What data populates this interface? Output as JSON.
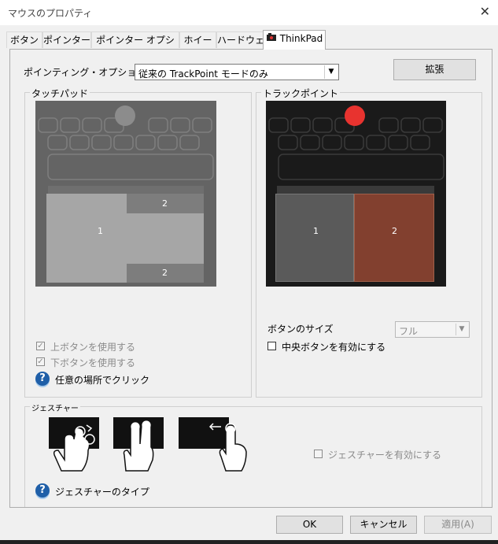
{
  "window": {
    "title": "マウスのプロパティ",
    "close_glyph": "✕"
  },
  "tabs": [
    {
      "label": "ボタン"
    },
    {
      "label": "ポインター"
    },
    {
      "label": "ポインター オプション"
    },
    {
      "label": "ホイール"
    },
    {
      "label": "ハードウェア"
    },
    {
      "label": "ThinkPad",
      "active": true
    }
  ],
  "pointing": {
    "label": "ポインティング・オプション",
    "selected": "従来の TrackPoint モードのみ",
    "expand_button": "拡張"
  },
  "touchpad": {
    "title": "タッチパッド",
    "zone_left": "1",
    "zone_top": "2",
    "zone_bottom": "2",
    "use_top_buttons": "上ボタンを使用する",
    "use_bottom_buttons": "下ボタンを使用する",
    "click_anywhere": "任意の場所でクリック",
    "check_glyph": "✓"
  },
  "trackpoint": {
    "title": "トラックポイント",
    "button_left": "1",
    "button_right": "2",
    "button_size_label": "ボタンのサイズ",
    "button_size_value": "フル",
    "middle_button": "中央ボタンを有効にする"
  },
  "gestures": {
    "title": "ジェスチャー",
    "enable": "ジェスチャーを有効にする",
    "types_label": "ジェスチャーのタイプ"
  },
  "help_glyph": "?",
  "arrow_glyph": "▼",
  "buttons": {
    "ok": "OK",
    "cancel": "キャンセル",
    "apply": "適用(A)"
  },
  "colors": {
    "trackpoint_red": "#e8332f",
    "active_button": "#82402f",
    "touchpad_bg": "#606060"
  }
}
